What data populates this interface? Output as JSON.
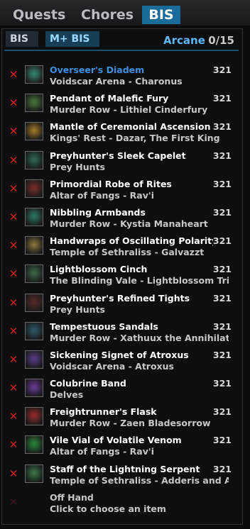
{
  "tabs": [
    "Quests",
    "Chores",
    "BIS"
  ],
  "subtabs": [
    "BIS",
    "M+ BIS"
  ],
  "spec": "Arcane",
  "progress": "0/15",
  "items": [
    {
      "name": "Overseer's Diadem",
      "source": "Voidscar Arena - Charonus",
      "ilvl": "321",
      "highlight": true,
      "icon_color": "#3b8a7a"
    },
    {
      "name": "Pendant of Malefic Fury",
      "source": "Murder Row - Lithiel Cinderfury",
      "ilvl": "321",
      "icon_color": "#4b7a3b"
    },
    {
      "name": "Mantle of Ceremonial Ascension",
      "source": "Kings' Rest - Dazar, The First King",
      "ilvl": "321",
      "icon_color": "#a87a2b"
    },
    {
      "name": "Preyhunter's Sleek Capelet",
      "source": "Prey Hunts",
      "ilvl": "321",
      "icon_color": "#2b6a5a"
    },
    {
      "name": "Primordial Robe of Rites",
      "source": "Altar of Fangs - Rav'i",
      "ilvl": "321",
      "icon_color": "#7a2b2b"
    },
    {
      "name": "Nibbling Armbands",
      "source": "Murder Row - Kystia Manaheart",
      "ilvl": "321",
      "icon_color": "#2b7a6a"
    },
    {
      "name": "Handwraps of Oscillating Polarity",
      "source": "Temple of Sethraliss - Galvazzt",
      "ilvl": "321",
      "icon_color": "#8a7a3b"
    },
    {
      "name": "Lightblossom Cinch",
      "source": "The Blinding Vale - Lightblossom Trinity",
      "ilvl": "321",
      "icon_color": "#3b6a4a"
    },
    {
      "name": "Preyhunter's Refined Tights",
      "source": "Prey Hunts",
      "ilvl": "321",
      "icon_color": "#5a2b2b"
    },
    {
      "name": "Tempestuous Sandals",
      "source": "Murder Row - Xathuux the Annihilator",
      "ilvl": "321",
      "icon_color": "#2b5a6a"
    },
    {
      "name": "Sickening Signet of Atroxus",
      "source": "Voidscar Arena - Atroxus",
      "ilvl": "321",
      "icon_color": "#5a3b8a"
    },
    {
      "name": "Colubrine Band",
      "source": "Delves",
      "ilvl": "321",
      "icon_color": "#6a3b9a"
    },
    {
      "name": "Freightrunner's Flask",
      "source": "Murder Row - Zaen Bladesorrow",
      "ilvl": "321",
      "icon_color": "#9a2b2b"
    },
    {
      "name": "Vile Vial of Volatile Venom",
      "source": "Altar of Fangs - Rav'i",
      "ilvl": "321",
      "icon_color": "#2b8a3b"
    },
    {
      "name": "Staff of the Lightning Serpent",
      "source": "Temple of Sethraliss - Adderis and As...",
      "ilvl": "321",
      "icon_color": "#3b7a4a"
    }
  ],
  "offhand": {
    "slot": "Off Hand",
    "hint": "Click to choose an item"
  }
}
